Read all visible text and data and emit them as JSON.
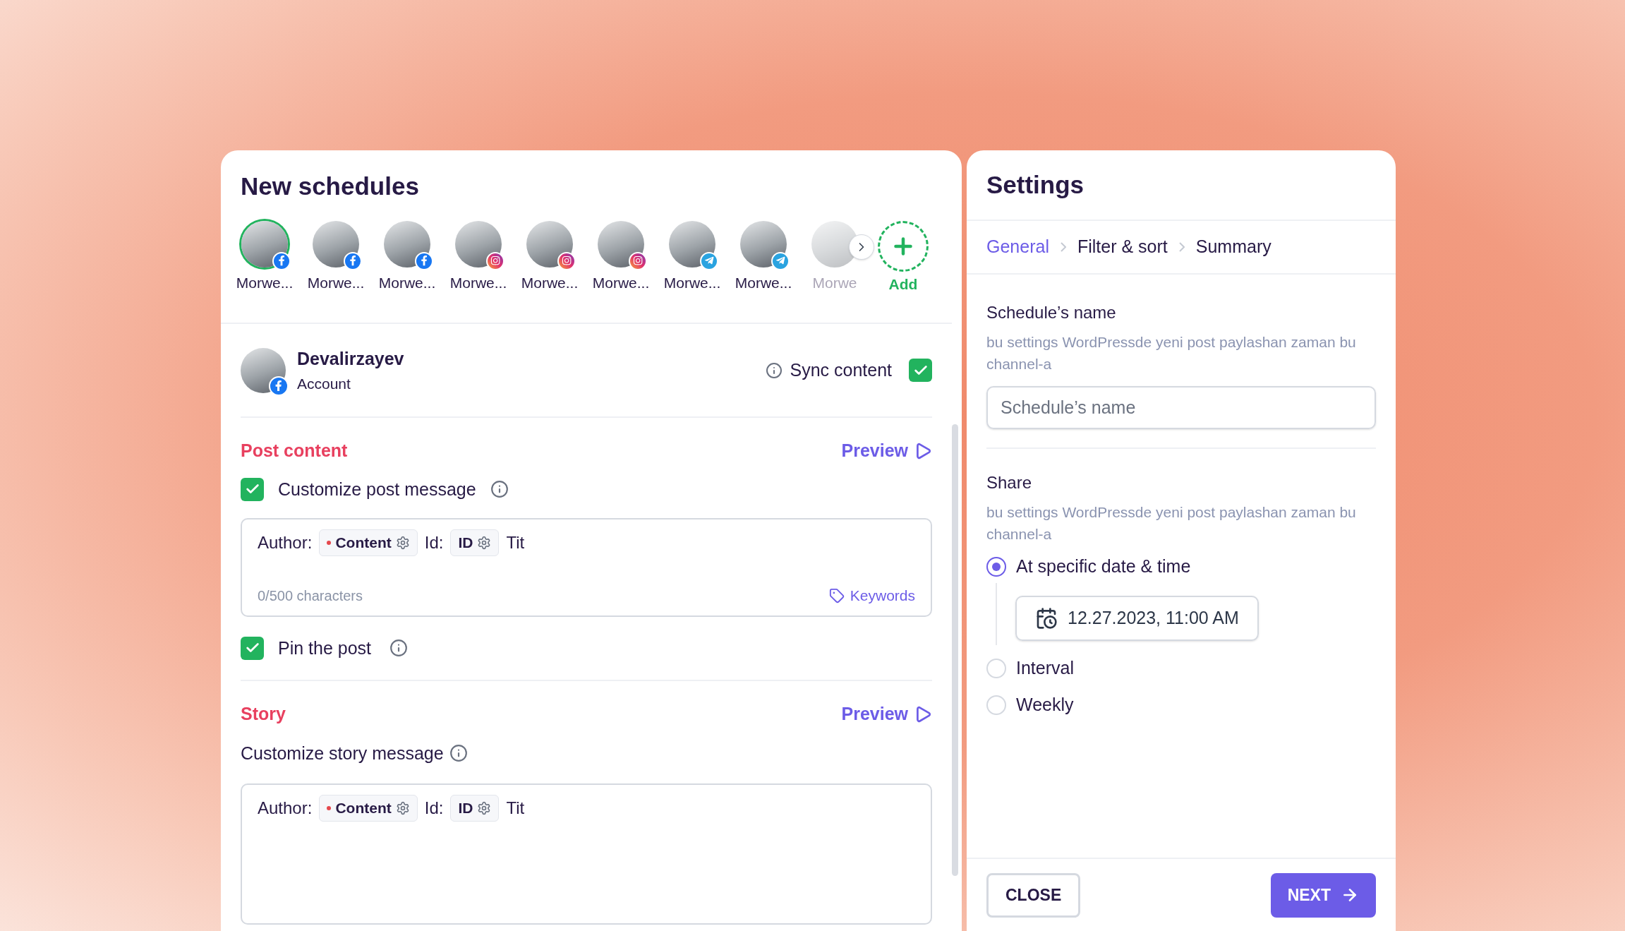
{
  "schedules": {
    "title": "New schedules",
    "accounts": [
      {
        "name": "Morwe...",
        "kind": "facebook",
        "selected": true,
        "faded": false
      },
      {
        "name": "Morwe...",
        "kind": "facebook",
        "selected": false,
        "faded": false
      },
      {
        "name": "Morwe...",
        "kind": "facebook",
        "selected": false,
        "faded": false
      },
      {
        "name": "Morwe...",
        "kind": "instagram",
        "selected": false,
        "faded": false
      },
      {
        "name": "Morwe...",
        "kind": "instagram",
        "selected": false,
        "faded": false
      },
      {
        "name": "Morwe...",
        "kind": "instagram",
        "selected": false,
        "faded": false
      },
      {
        "name": "Morwe...",
        "kind": "telegram",
        "selected": false,
        "faded": false
      },
      {
        "name": "Morwe...",
        "kind": "telegram",
        "selected": false,
        "faded": false
      },
      {
        "name": "Morwe",
        "selected": false,
        "faded": true
      }
    ],
    "add_label": "Add"
  },
  "account": {
    "name": "Devalirzayev",
    "role": "Account",
    "kind": "facebook",
    "sync": {
      "label": "Sync content",
      "checked": true
    }
  },
  "post_content": {
    "title": "Post content",
    "preview": "Preview",
    "customize": {
      "label": "Customize post message",
      "checked": true
    },
    "editor": {
      "segments": [
        {
          "kind": "text",
          "text": "Author:"
        },
        {
          "kind": "tag",
          "text": "Content",
          "dot": true
        },
        {
          "kind": "text",
          "text": "Id:"
        },
        {
          "kind": "tag",
          "text": "ID",
          "dot": false
        },
        {
          "kind": "text",
          "text": "Tit"
        }
      ],
      "counter": "0/500 characters",
      "keywords": "Keywords"
    },
    "pin": {
      "label": "Pin the post",
      "checked": true
    }
  },
  "story": {
    "title": "Story",
    "preview": "Preview",
    "customize_label": "Customize story message",
    "editor": {
      "segments": [
        {
          "kind": "text",
          "text": "Author:"
        },
        {
          "kind": "tag",
          "text": "Content",
          "dot": true
        },
        {
          "kind": "text",
          "text": "Id:"
        },
        {
          "kind": "tag",
          "text": "ID",
          "dot": false
        },
        {
          "kind": "text",
          "text": "Tit"
        }
      ]
    }
  },
  "settings": {
    "title": "Settings",
    "steps": [
      {
        "label": "General",
        "selected": true
      },
      {
        "label": "Filter & sort",
        "selected": false
      },
      {
        "label": "Summary",
        "selected": false
      }
    ],
    "name_section": {
      "label": "Schedule’s name",
      "description": "bu settings WordPressde yeni post paylashan zaman bu channel-a",
      "placeholder": "Schedule’s name"
    },
    "share": {
      "label": "Share",
      "description": "bu settings WordPressde yeni post paylashan zaman bu channel-a",
      "options": [
        {
          "label": "At specific date & time",
          "selected": true,
          "value": "12.27.2023, 11:00 AM"
        },
        {
          "label": "Interval",
          "selected": false
        },
        {
          "label": "Weekly",
          "selected": false
        }
      ]
    },
    "buttons": {
      "close": "CLOSE",
      "next": "NEXT"
    }
  }
}
